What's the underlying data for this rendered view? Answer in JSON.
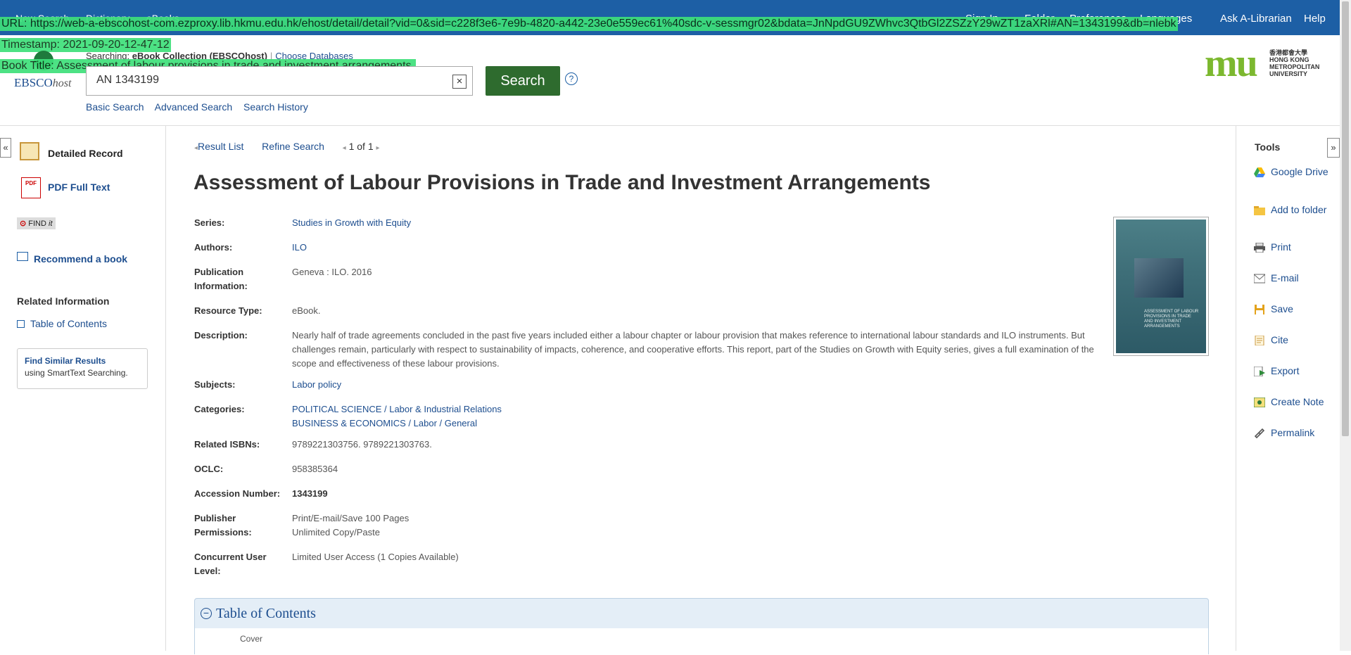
{
  "topbar": {
    "left_links": [
      "New Search",
      "Dictionary",
      "eBooks"
    ],
    "right_links": [
      "Sign In",
      "Folder",
      "Preferences",
      "Languages",
      "Ask A-Librarian",
      "Help"
    ]
  },
  "overlay": {
    "url": "URL: https://web-a-ebscohost-com.ezproxy.lib.hkmu.edu.hk/ehost/detail/detail?vid=0&sid=c228f3e6-7e9b-4820-a442-23e0e559ec61%40sdc-v-sessmgr02&bdata=JnNpdGU9ZWhvc3QtbGl2ZSZzY29wZT1zaXRl#AN=1343199&db=nlebk",
    "timestamp": "Timestamp: 2021-09-20-12-47-12",
    "book_title": "Book Title: Assessment of labour provisions in trade and investment arrangements."
  },
  "header": {
    "logo_text": "EBSCO",
    "logo_host": "host",
    "searching_label": "Searching:",
    "database": "eBook Collection (EBSCOhost)",
    "choose_db": "Choose Databases",
    "query": "AN 1343199",
    "search_label": "Search",
    "help_label": "?",
    "links": [
      "Basic Search",
      "Advanced Search",
      "Search History"
    ]
  },
  "university": {
    "logo_mark": "mu",
    "name_zh": "香港都會大學",
    "name_en_1": "HONG KONG",
    "name_en_2": "METROPOLITAN",
    "name_en_3": "UNIVERSITY"
  },
  "left_nav": {
    "collapse": "«",
    "detailed_record": "Detailed Record",
    "pdf_icon": "PDF",
    "pdf_full_text": "PDF Full Text",
    "find_it_1": "FIND",
    "find_it_2": "it",
    "recommend": "Recommend a book",
    "related_info": "Related Information",
    "toc": "Table of Contents",
    "similar_title": "Find Similar Results",
    "similar_sub": "using SmartText Searching."
  },
  "breadcrumb": {
    "result_list": "Result List",
    "refine": "Refine Search",
    "page_count": "1 of 1"
  },
  "record": {
    "title": "Assessment of Labour Provisions in Trade and Investment Arrangements",
    "fields": [
      {
        "label": "Series:",
        "value": "Studies in Growth with Equity",
        "link": true
      },
      {
        "label": "Authors:",
        "value": "ILO",
        "link": true
      },
      {
        "label": "Publication Information:",
        "value": "Geneva : ILO. 2016",
        "link": false
      },
      {
        "label": "Resource Type:",
        "value": "eBook.",
        "link": false
      },
      {
        "label": "Description:",
        "value": "Nearly half of trade agreements concluded in the past five years included either a labour chapter or labour provision that makes reference to international labour standards and ILO instruments. But challenges remain, particularly with respect to sustainability of impacts, coherence, and cooperative efforts. This report, part of the Studies on Growth with Equity series, gives a full examination of the scope and effectiveness of these labour provisions.",
        "link": false
      },
      {
        "label": "Subjects:",
        "value": "Labor policy",
        "link": true
      },
      {
        "label": "Categories:",
        "value": "POLITICAL SCIENCE / Labor & Industrial Relations",
        "value2": "BUSINESS & ECONOMICS / Labor / General",
        "link": true
      },
      {
        "label": "Related ISBNs:",
        "value": "9789221303756. 9789221303763.",
        "link": false
      },
      {
        "label": "OCLC:",
        "value": "958385364",
        "link": false
      },
      {
        "label": "Accession Number:",
        "value": "1343199",
        "link": false,
        "bold": true
      },
      {
        "label": "Publisher Permissions:",
        "value": "Print/E-mail/Save 100 Pages",
        "value2": "Unlimited Copy/Paste",
        "link": false
      },
      {
        "label": "Concurrent User Level:",
        "value": "Limited User Access (1 Copies Available)",
        "link": false
      }
    ],
    "cover_text": "ASSESSMENT OF LABOUR PROVISIONS IN TRADE AND INVESTMENT ARRANGEMENTS"
  },
  "toc_panel": {
    "toggle": "−",
    "title": "Table of Contents",
    "first_item": "Cover"
  },
  "tools": {
    "collapse": "»",
    "title": "Tools",
    "items": [
      "Google Drive",
      "Add to folder",
      "Print",
      "E-mail",
      "Save",
      "Cite",
      "Export",
      "Create Note",
      "Permalink"
    ]
  }
}
